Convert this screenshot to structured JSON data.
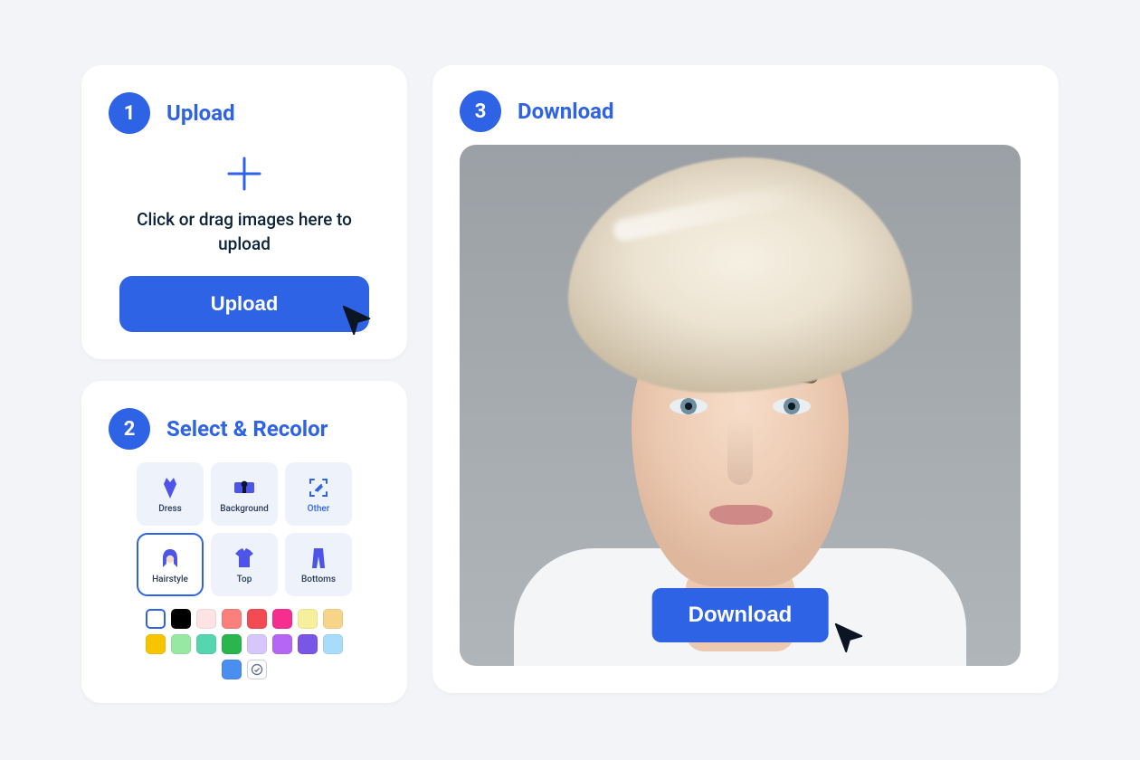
{
  "steps": {
    "upload": {
      "number": "1",
      "title": "Upload"
    },
    "recolor": {
      "number": "2",
      "title": "Select & Recolor"
    },
    "download": {
      "number": "3",
      "title": "Download"
    }
  },
  "upload": {
    "hint": "Click or drag images here to upload",
    "button": "Upload"
  },
  "categories": [
    {
      "key": "dress",
      "label": "Dress"
    },
    {
      "key": "background",
      "label": "Background"
    },
    {
      "key": "other",
      "label": "Other"
    },
    {
      "key": "hairstyle",
      "label": "Hairstyle",
      "selected": true
    },
    {
      "key": "top",
      "label": "Top"
    },
    {
      "key": "bottoms",
      "label": "Bottoms"
    }
  ],
  "swatches": [
    "#ffffff",
    "#000000",
    "#fde3e3",
    "#fb7f7b",
    "#f24b53",
    "#f52e8f",
    "#f6ef9c",
    "#f6d58b",
    "#f7c500",
    "#97e8a2",
    "#55d6b0",
    "#2ab54f",
    "#d7c6fb",
    "#b666f4",
    "#7a56e8",
    "#a7dcfb",
    "#4a8ef0"
  ],
  "download": {
    "button": "Download"
  },
  "colors": {
    "primary": "#2f63e6"
  }
}
